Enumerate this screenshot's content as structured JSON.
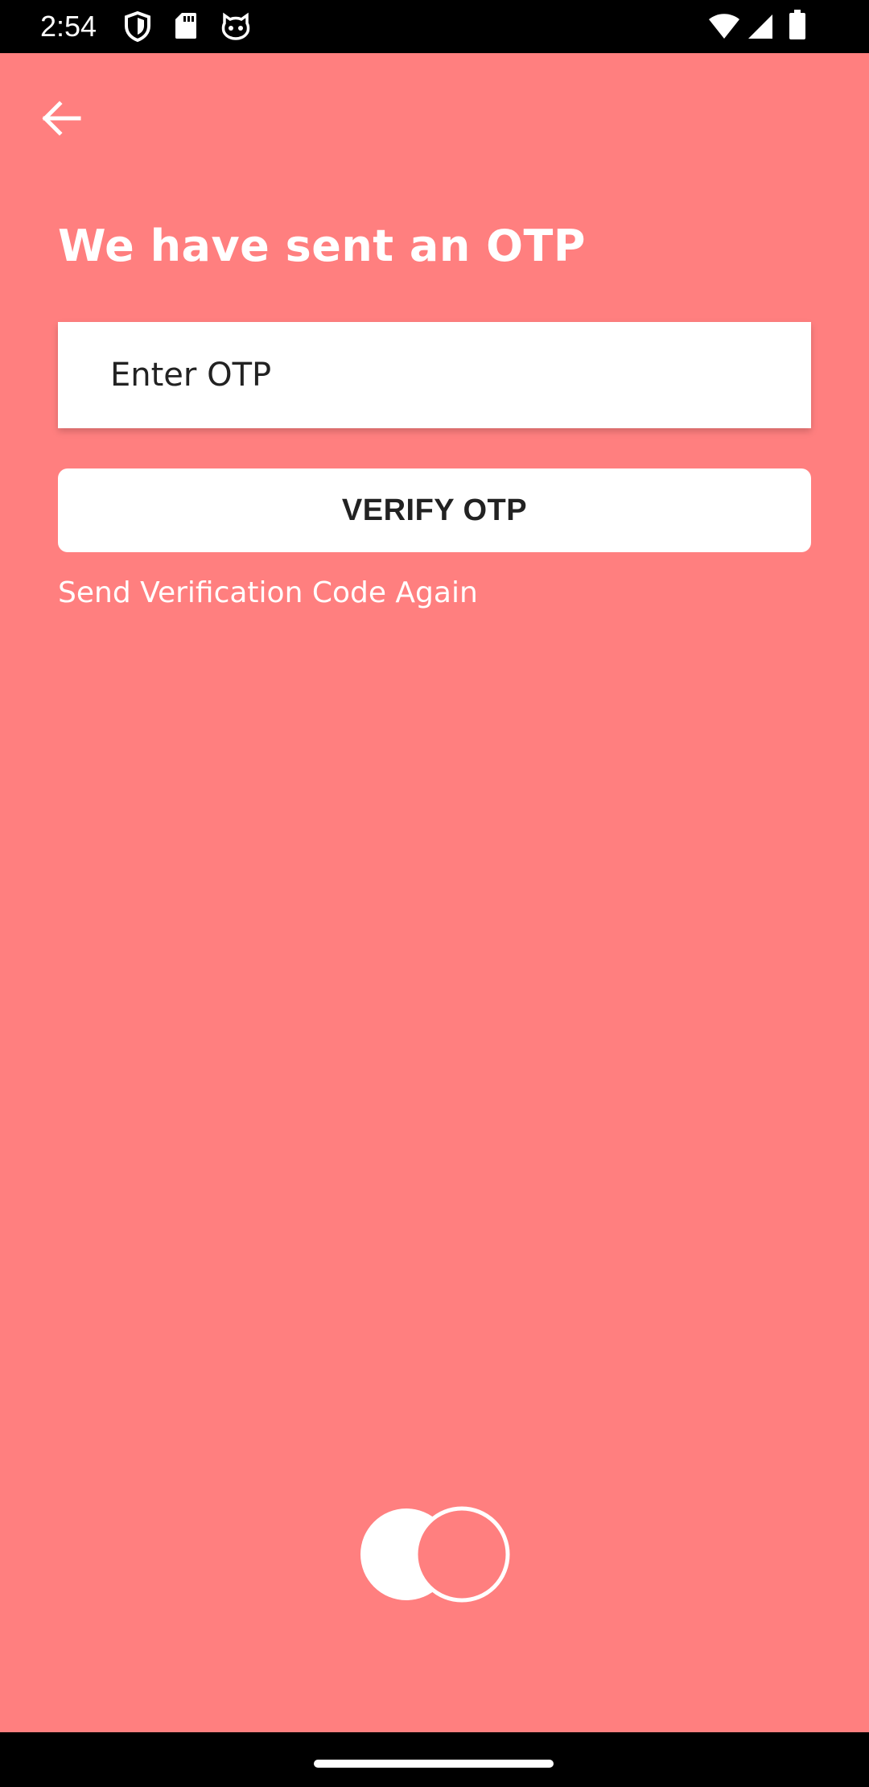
{
  "status_bar": {
    "time": "2:54",
    "icons": [
      "shield-icon",
      "sd-card-icon",
      "cat-face-icon",
      "wifi-icon",
      "signal-icon",
      "battery-icon"
    ]
  },
  "header": {
    "back_icon": "arrow-left-icon"
  },
  "main": {
    "title": "We have sent an OTP",
    "otp_input": {
      "placeholder": "Enter OTP",
      "value": ""
    },
    "verify_button_label": "VERIFY OTP",
    "resend_link_label": "Send Verification Code Again"
  },
  "loader": {
    "icon": "loading-circles-icon"
  },
  "colors": {
    "background": "#FF7F7F",
    "surface": "#FFFFFF",
    "text_dark": "#222222",
    "bars": "#000000"
  }
}
